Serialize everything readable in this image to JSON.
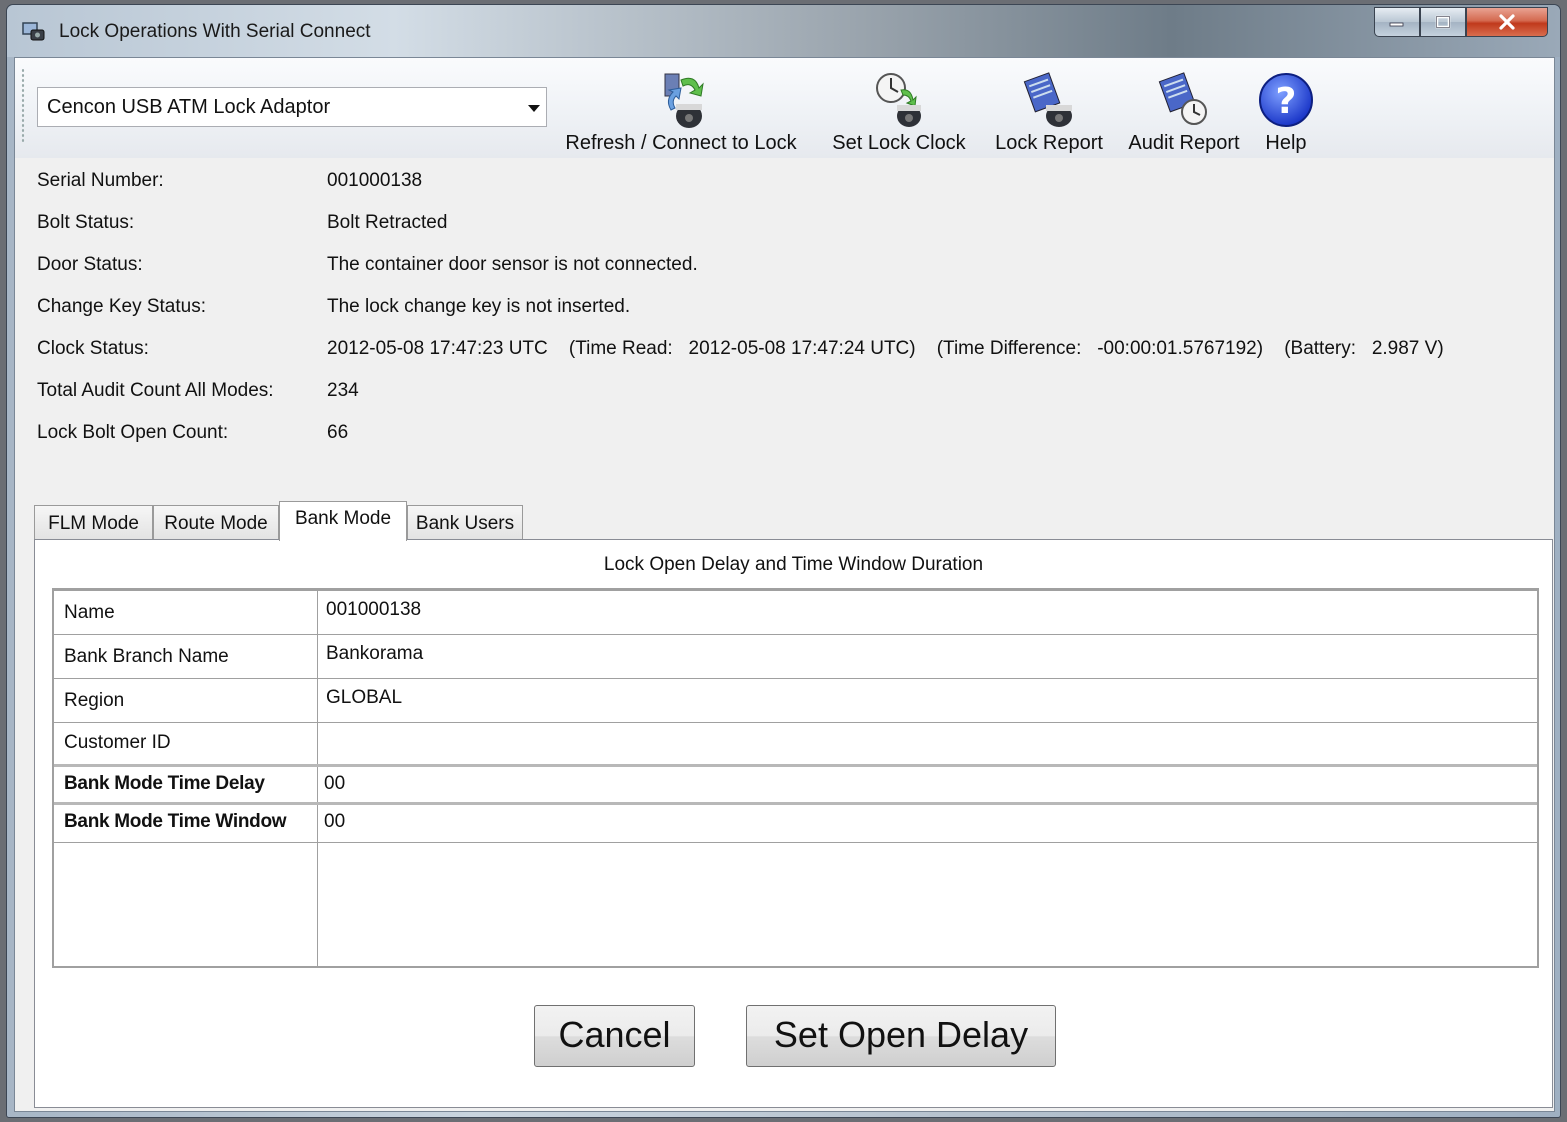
{
  "window": {
    "title": "Lock Operations With Serial Connect",
    "caption_buttons": [
      "minimize",
      "maximize",
      "close"
    ]
  },
  "toolbar": {
    "device_combo": {
      "selected": "Cencon USB ATM Lock Adaptor"
    },
    "buttons": [
      {
        "label": "Refresh / Connect to Lock",
        "icon": "refresh-lock-icon"
      },
      {
        "label": "Set Lock Clock",
        "icon": "lock-clock-icon"
      },
      {
        "label": "Lock Report",
        "icon": "lock-report-icon"
      },
      {
        "label": "Audit Report",
        "icon": "audit-report-icon"
      },
      {
        "label": "Help",
        "icon": "help-icon"
      }
    ]
  },
  "info": {
    "serial_number": {
      "label": "Serial Number:",
      "value": "001000138"
    },
    "bolt_status": {
      "label": "Bolt Status:",
      "value": "Bolt Retracted"
    },
    "door_status": {
      "label": "Door Status:",
      "value": "The container door sensor is not connected."
    },
    "change_key_status": {
      "label": "Change Key Status:",
      "value": "The lock change key is not inserted."
    },
    "clock_status": {
      "label": "Clock Status:",
      "value": "2012-05-08 17:47:23 UTC    (Time Read:   2012-05-08 17:47:24 UTC)    (Time Difference:   -00:00:01.5767192)    (Battery:   2.987 V)"
    },
    "total_audit_count": {
      "label": "Total Audit Count All Modes:",
      "value": "234"
    },
    "lock_bolt_open_count": {
      "label": "Lock Bolt Open Count:",
      "value": "66"
    }
  },
  "tabs": [
    "FLM Mode",
    "Route Mode",
    "Bank Mode",
    "Bank Users"
  ],
  "active_tab": "Bank Mode",
  "panel": {
    "title": "Lock Open Delay and Time Window Duration",
    "rows": [
      {
        "label": "Name",
        "value": "001000138"
      },
      {
        "label": "Bank Branch Name",
        "value": "Bankorama"
      },
      {
        "label": "Region",
        "value": "GLOBAL"
      },
      {
        "label": "Customer ID",
        "value": ""
      },
      {
        "label": "Bank Mode Time Delay",
        "value": "00"
      },
      {
        "label": "Bank Mode Time Window",
        "value": "00"
      }
    ],
    "cancel_label": "Cancel",
    "set_label": "Set Open Delay"
  }
}
